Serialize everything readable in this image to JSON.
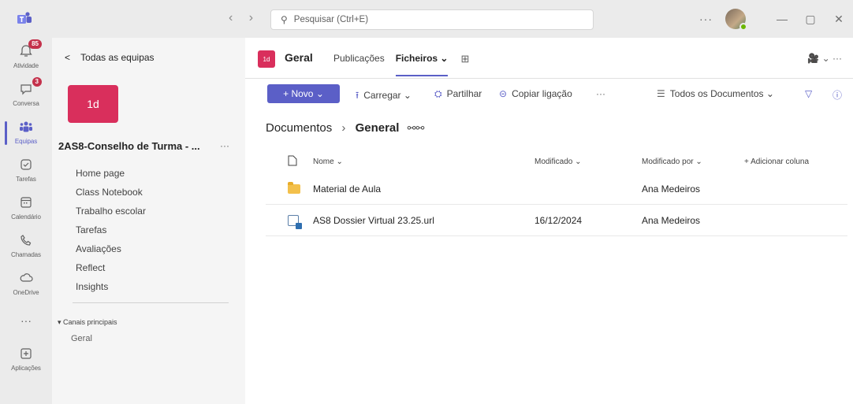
{
  "titlebar": {
    "nav_back": "‹",
    "nav_forward": "›",
    "search_placeholder": "Pesquisar (Ctrl+E)",
    "more": "···",
    "minimize": "—",
    "restore": "▢",
    "close": "✕"
  },
  "rail": {
    "items": [
      {
        "label": "Atividade",
        "icon": "bell-icon",
        "badge": "85"
      },
      {
        "label": "Conversa",
        "icon": "chat-icon",
        "badge": "3"
      },
      {
        "label": "Equipas",
        "icon": "teams-icon",
        "active": true
      },
      {
        "label": "Tarefas",
        "icon": "tasks-icon"
      },
      {
        "label": "Calendário",
        "icon": "calendar-icon"
      },
      {
        "label": "Chamadas",
        "icon": "phone-icon"
      },
      {
        "label": "OneDrive",
        "icon": "cloud-icon"
      },
      {
        "label": "",
        "icon": "more-icon"
      },
      {
        "label": "Aplicações",
        "icon": "apps-icon"
      }
    ]
  },
  "teampane": {
    "back_label": "Todas as equipas",
    "team_avatar_text": "1d",
    "team_name": "2AS8-Conselho de Turma - ...",
    "team_more": "···",
    "links": [
      "Home page",
      "Class Notebook",
      "Trabalho escolar",
      "Tarefas",
      "Avaliações",
      "Reflect",
      "Insights"
    ],
    "channels_label": "▾ Canais principais",
    "channel": "Geral"
  },
  "channel": {
    "avatar_text": "1d",
    "name": "Geral",
    "tabs": [
      "Publicações",
      "Ficheiros ⌄"
    ],
    "add_tab": "⊞",
    "right": "🎥 ⌄ ···"
  },
  "toolbar": {
    "new_label": "+ Novo ⌄",
    "upload_label": "Carregar ⌄",
    "share_label": "Partilhar",
    "copy_link_label": "Copiar ligação",
    "more": "···",
    "view_label": "Todos os Documentos ⌄",
    "filter": "▽",
    "info": "ⓘ"
  },
  "breadcrumb": {
    "root": "Documentos",
    "sep": "›",
    "current": "General"
  },
  "table": {
    "headers": {
      "name": "Nome ⌄",
      "modified": "Modificado ⌄",
      "modified_by": "Modificado por ⌄",
      "add_column": "+ Adicionar coluna"
    },
    "rows": [
      {
        "type": "folder",
        "name": "Material de Aula",
        "modified": "",
        "modified_by": "Ana Medeiros"
      },
      {
        "type": "link",
        "name": "AS8 Dossier Virtual 23.25.url",
        "modified": "16/12/2024",
        "modified_by": "Ana Medeiros"
      }
    ]
  },
  "colors": {
    "accent": "#5b5fc7",
    "team": "#d92f5c",
    "badge": "#c4314b"
  }
}
